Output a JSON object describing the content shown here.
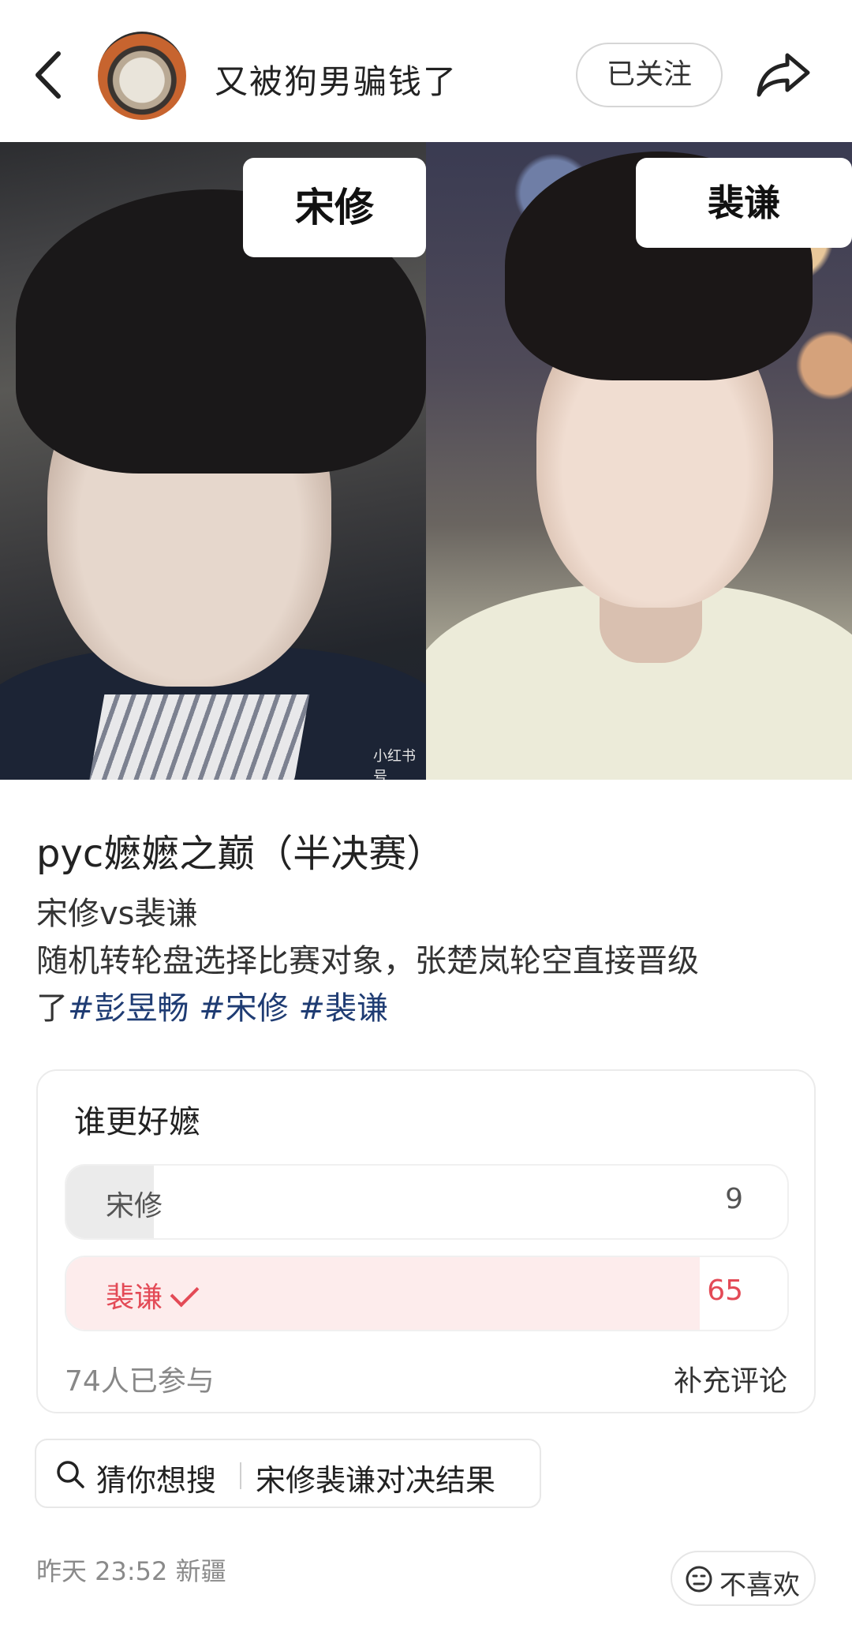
{
  "header": {
    "author_name": "又被狗男骗钱了",
    "follow_label": "已关注"
  },
  "gallery": {
    "left_name": "宋修",
    "right_name": "裴谦",
    "watermark": "小红书号"
  },
  "post": {
    "title": "pyc嬷嬷之巅（半决赛）",
    "body_line1": "宋修vs裴谦",
    "body_line2": "随机转轮盘选择比赛对象，张楚岚轮空直接晋级",
    "body_line3_prefix": "了",
    "tags": [
      "#彭昱畅",
      "#宋修",
      "#裴谦"
    ]
  },
  "poll": {
    "question": "谁更好嬷",
    "options": [
      {
        "label": "宋修",
        "count": "9",
        "share": 0.1216
      },
      {
        "label": "裴谦",
        "count": "65",
        "share": 0.8784,
        "selected": true
      }
    ],
    "participants": "74人已参与",
    "add_comment": "补充评论"
  },
  "search": {
    "label": "猜你想搜",
    "query": "宋修裴谦对决结果"
  },
  "footer": {
    "meta": "昨天 23:52 新疆",
    "dislike_label": "不喜欢"
  },
  "colors": {
    "tag": "#1f3c73",
    "selected_accent": "#e34a56",
    "selected_fill": "#fdecec"
  }
}
